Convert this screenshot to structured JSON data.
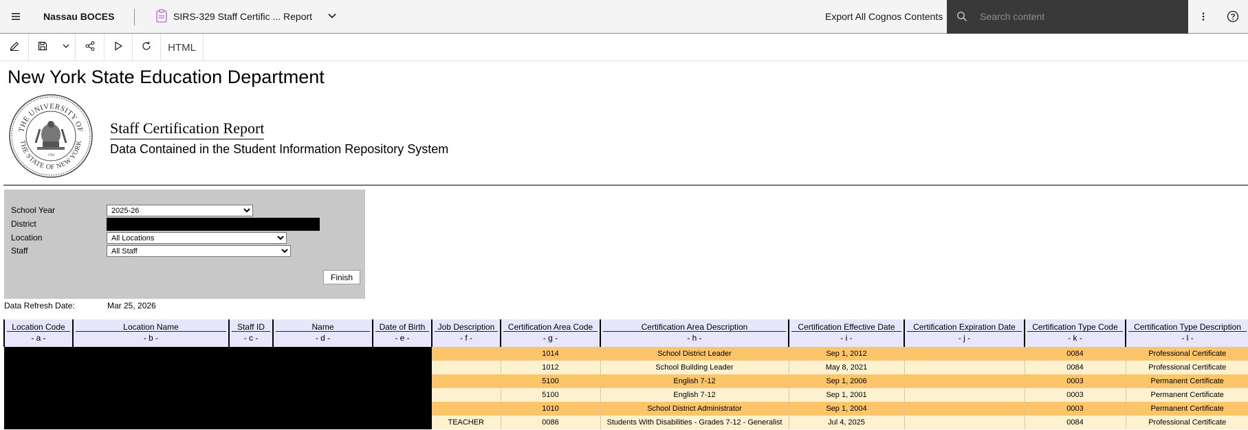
{
  "topbar": {
    "brand": "Nassau BOCES",
    "report_title": "SIRS-329 Staff Certific ... Report",
    "export_label": "Export All Cognos Contents",
    "search_placeholder": "Search content"
  },
  "toolbar": {
    "format_label": "HTML"
  },
  "report": {
    "department": "New York State Education Department",
    "title": "Staff Certification Report",
    "subtitle": "Data Contained in the Student Information Repository System",
    "seal_text": [
      "THE UNIVERSITY OF",
      "THE STATE OF NEW YORK",
      "1784"
    ]
  },
  "prompts": {
    "school_year_label": "School Year",
    "school_year_value": "2025-26",
    "district_label": "District",
    "location_label": "Location",
    "location_value": "All Locations",
    "staff_label": "Staff",
    "staff_value": "All Staff",
    "finish_label": "Finish"
  },
  "refresh": {
    "label": "Data Refresh Date:",
    "value": "Mar 25, 2026"
  },
  "table": {
    "columns": [
      {
        "name": "Location Code",
        "code": "- a -"
      },
      {
        "name": "Location Name",
        "code": "- b -"
      },
      {
        "name": "Staff ID",
        "code": "- c -"
      },
      {
        "name": "Name",
        "code": "- d -"
      },
      {
        "name": "Date of Birth",
        "code": "- e -"
      },
      {
        "name": "Job Description",
        "code": "- f -"
      },
      {
        "name": "Certification Area Code",
        "code": "- g -"
      },
      {
        "name": "Certification Area Description",
        "code": "- h -"
      },
      {
        "name": "Certification Effective Date",
        "code": "- i -"
      },
      {
        "name": "Certification Expiration Date",
        "code": "- j -"
      },
      {
        "name": "Certification Type Code",
        "code": "- k -"
      },
      {
        "name": "Certification Type Description",
        "code": "- l -"
      }
    ],
    "rows": [
      {
        "job": "",
        "area_code": "1014",
        "area_desc": "School District Leader",
        "eff": "Sep 1, 2012",
        "exp": "",
        "type_code": "0084",
        "type_desc": "Professional Certificate"
      },
      {
        "job": "",
        "area_code": "1012",
        "area_desc": "School Building Leader",
        "eff": "May 8, 2021",
        "exp": "",
        "type_code": "0084",
        "type_desc": "Professional Certificate"
      },
      {
        "job": "",
        "area_code": "5100",
        "area_desc": "English 7-12",
        "eff": "Sep 1, 2006",
        "exp": "",
        "type_code": "0003",
        "type_desc": "Permanent Certificate"
      },
      {
        "job": "",
        "area_code": "5100",
        "area_desc": "English 7-12",
        "eff": "Sep 1, 2001",
        "exp": "",
        "type_code": "0003",
        "type_desc": "Permanent Certificate"
      },
      {
        "job": "",
        "area_code": "1010",
        "area_desc": "School District Administrator",
        "eff": "Sep 1, 2004",
        "exp": "",
        "type_code": "0003",
        "type_desc": "Permanent Certificate"
      },
      {
        "job": "TEACHER",
        "area_code": "0086",
        "area_desc": "Students With Disabilities - Grades 7-12 - Generalist",
        "eff": "Jul 4, 2025",
        "exp": "",
        "type_code": "0084",
        "type_desc": "Professional Certificate"
      }
    ]
  },
  "colors": {
    "row_dark": "#fcc56a",
    "row_light": "#fdf1cf",
    "header_bg": "#e8e6fa",
    "prompt_bg": "#c8c8c8",
    "search_bg": "#393939"
  }
}
